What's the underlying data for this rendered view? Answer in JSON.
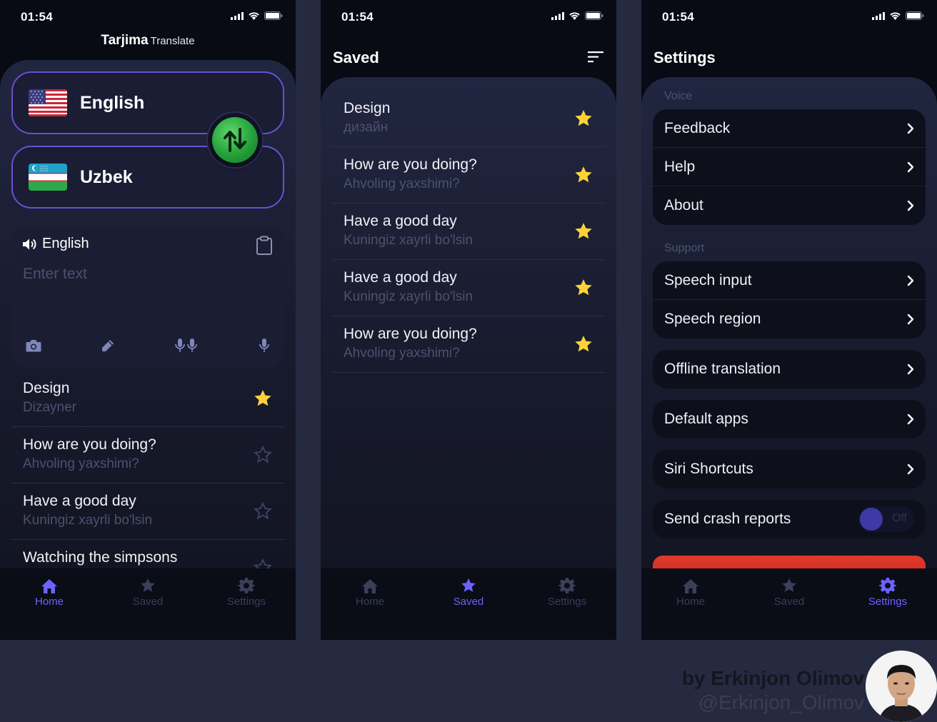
{
  "status_time": "01:54",
  "home": {
    "app_title": "Tarjima",
    "app_subtitle": "Translate",
    "source_language": "English",
    "target_language": "Uzbek",
    "input": {
      "language_label": "English",
      "placeholder": "Enter text"
    },
    "history": [
      {
        "text": "Design",
        "translation": "Dizayner",
        "starred": true
      },
      {
        "text": "How are you doing?",
        "translation": "Ahvoling yaxshimi?",
        "starred": false
      },
      {
        "text": "Have a good day",
        "translation": "Kuningiz xayrli bo'lsin",
        "starred": false
      },
      {
        "text": "Watching the simpsons",
        "translation": "",
        "starred": false
      }
    ]
  },
  "saved": {
    "title": "Saved",
    "items": [
      {
        "text": "Design",
        "translation": "дизайн",
        "starred": true
      },
      {
        "text": "How are you doing?",
        "translation": "Ahvoling yaxshimi?",
        "starred": true
      },
      {
        "text": "Have a good day",
        "translation": "Kuningiz xayrli bo'lsin",
        "starred": true
      },
      {
        "text": "Have a good day",
        "translation": "Kuningiz xayrli bo'lsin",
        "starred": true
      },
      {
        "text": "How are you doing?",
        "translation": "Ahvoling yaxshimi?",
        "starred": true
      }
    ]
  },
  "settings": {
    "title": "Settings",
    "voice_label": "Voice",
    "voice_items": [
      "Feedback",
      "Help",
      "About"
    ],
    "support_label": "Support",
    "support_items": [
      "Speech input",
      "Speech region"
    ],
    "offline_translation": "Offline translation",
    "default_apps": "Default apps",
    "siri_shortcuts": "Siri Shortcuts",
    "send_crash_reports": "Send crash reports",
    "toggle_state": "Off"
  },
  "tabs": {
    "home": "Home",
    "saved": "Saved",
    "settings": "Settings"
  },
  "credit": {
    "by": "by Erkinjon Olimov",
    "handle": "@Erkinjon_Olimov"
  },
  "colors": {
    "accent": "#6b63ff",
    "star": "#ffd23a",
    "swap_button": "#23a03a",
    "card_border": "#6a4fd2",
    "danger": "#d42c20"
  },
  "icons": [
    "signal-icon",
    "wifi-icon",
    "battery-icon",
    "swap-icon",
    "speaker-icon",
    "clipboard-icon",
    "camera-icon",
    "pen-icon",
    "conversation-mic-icon",
    "mic-icon",
    "star-icon",
    "sort-icon",
    "chevron-right-icon",
    "home-icon",
    "settings-gear-icon"
  ]
}
